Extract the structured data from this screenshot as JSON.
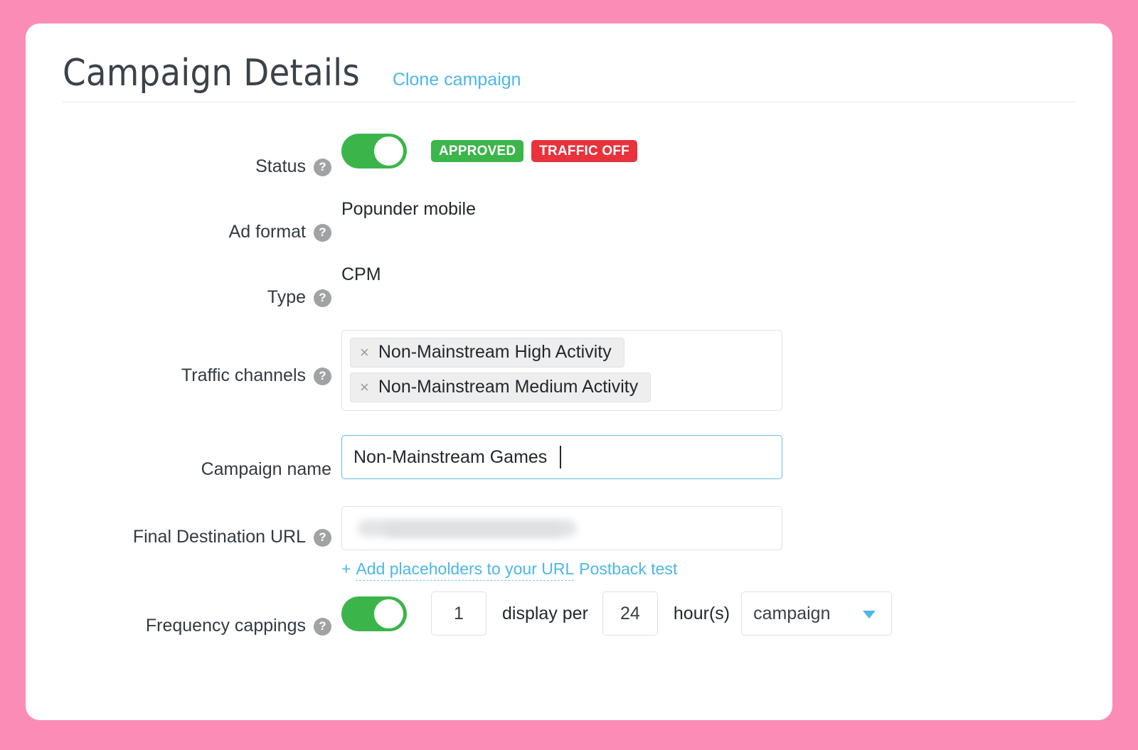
{
  "header": {
    "title": "Campaign Details",
    "clone_link": "Clone campaign"
  },
  "help_icon_glyph": "?",
  "colors": {
    "page_background": "#fb8cb6",
    "card_background": "#ffffff",
    "accent_link": "#4cb7e8",
    "toggle_on": "#3bb54a",
    "badge_approved": "#3cb54b",
    "badge_traffic_off": "#e8323c",
    "input_border": "#dfe2e6",
    "input_border_focus": "#63b9e4",
    "chip_background": "#eeeeee"
  },
  "fields": {
    "status": {
      "label": "Status",
      "toggle_on": true,
      "badges": [
        {
          "text": "APPROVED",
          "variant": "approved"
        },
        {
          "text": "TRAFFIC OFF",
          "variant": "traffic-off"
        }
      ]
    },
    "ad_format": {
      "label": "Ad format",
      "value": "Popunder mobile"
    },
    "type": {
      "label": "Type",
      "value": "CPM"
    },
    "traffic_channels": {
      "label": "Traffic channels",
      "remove_glyph": "×",
      "chips": [
        "Non-Mainstream High Activity",
        "Non-Mainstream Medium Activity"
      ]
    },
    "campaign_name": {
      "label": "Campaign name",
      "value": "Non-Mainstream Games",
      "placeholder": "Campaign name",
      "focused": true
    },
    "final_destination_url": {
      "label": "Final Destination URL",
      "value": "",
      "placeholder": "",
      "value_redacted": true,
      "links": {
        "plus": "+",
        "add_placeholders": "Add placeholders to your URL",
        "postback_test": "Postback test"
      }
    },
    "frequency_cappings": {
      "label": "Frequency cappings",
      "toggle_on": true,
      "display_count": "1",
      "middle_text": "display per",
      "hours_value": "24",
      "hours_text": "hour(s)",
      "scope_value": "campaign"
    }
  }
}
